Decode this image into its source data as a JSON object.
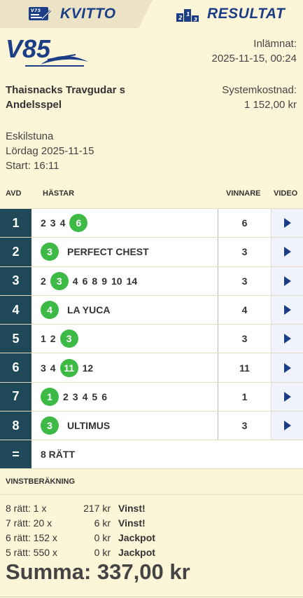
{
  "tabs": {
    "kvitto": "KVITTO",
    "resultat": "RESULTAT"
  },
  "logo": {
    "text": "V85",
    "icon": "v85-logo"
  },
  "submitted": {
    "label": "Inlämnat:",
    "value": "2025-11-15, 00:24"
  },
  "ticket": {
    "name_line1": "Thaisnacks Travgudar s",
    "name_line2": "Andelsspel",
    "cost_label": "Systemkostnad:",
    "cost_value": "1 152,00 kr"
  },
  "race": {
    "track": "Eskilstuna",
    "date": "Lördag 2025-11-15",
    "start": "Start: 16:11"
  },
  "columns": {
    "avd": "AVD",
    "hastar": "HÄSTAR",
    "vinnare": "VINNARE",
    "video": "VIDEO"
  },
  "rows": [
    {
      "avd": "1",
      "horses": [
        "2",
        "3",
        "4",
        "6"
      ],
      "winner_index": 3,
      "name": "",
      "winner": "6"
    },
    {
      "avd": "2",
      "horses": [
        "3"
      ],
      "winner_index": 0,
      "name": "PERFECT CHEST",
      "winner": "3"
    },
    {
      "avd": "3",
      "horses": [
        "2",
        "3",
        "4",
        "6",
        "8",
        "9",
        "10",
        "14"
      ],
      "winner_index": 1,
      "name": "",
      "winner": "3"
    },
    {
      "avd": "4",
      "horses": [
        "4"
      ],
      "winner_index": 0,
      "name": "LA YUCA",
      "winner": "4"
    },
    {
      "avd": "5",
      "horses": [
        "1",
        "2",
        "3"
      ],
      "winner_index": 2,
      "name": "",
      "winner": "3"
    },
    {
      "avd": "6",
      "horses": [
        "3",
        "4",
        "11",
        "12"
      ],
      "winner_index": 2,
      "name": "",
      "winner": "11"
    },
    {
      "avd": "7",
      "horses": [
        "1",
        "2",
        "3",
        "4",
        "5",
        "6"
      ],
      "winner_index": 0,
      "name": "",
      "winner": "1"
    },
    {
      "avd": "8",
      "horses": [
        "3"
      ],
      "winner_index": 0,
      "name": "ULTIMUS",
      "winner": "3"
    }
  ],
  "result": {
    "symbol": "=",
    "text": "8 RÄTT"
  },
  "vinst": {
    "heading": "VINSTBERÄKNING",
    "lines": [
      {
        "label": "8 rätt: 1 x",
        "amount": "217 kr",
        "status": "Vinst!"
      },
      {
        "label": "7 rätt: 20 x",
        "amount": "6 kr",
        "status": "Vinst!"
      },
      {
        "label": "6 rätt: 152 x",
        "amount": "0 kr",
        "status": "Jackpot"
      },
      {
        "label": "5 rätt: 550 x",
        "amount": "0 kr",
        "status": "Jackpot"
      }
    ],
    "summa": "Summa: 337,00 kr"
  },
  "colors": {
    "background": "#fdf5d8",
    "brand_blue": "#1c3e86",
    "avd_dark": "#1f4859",
    "winner_green": "#3dba46"
  }
}
